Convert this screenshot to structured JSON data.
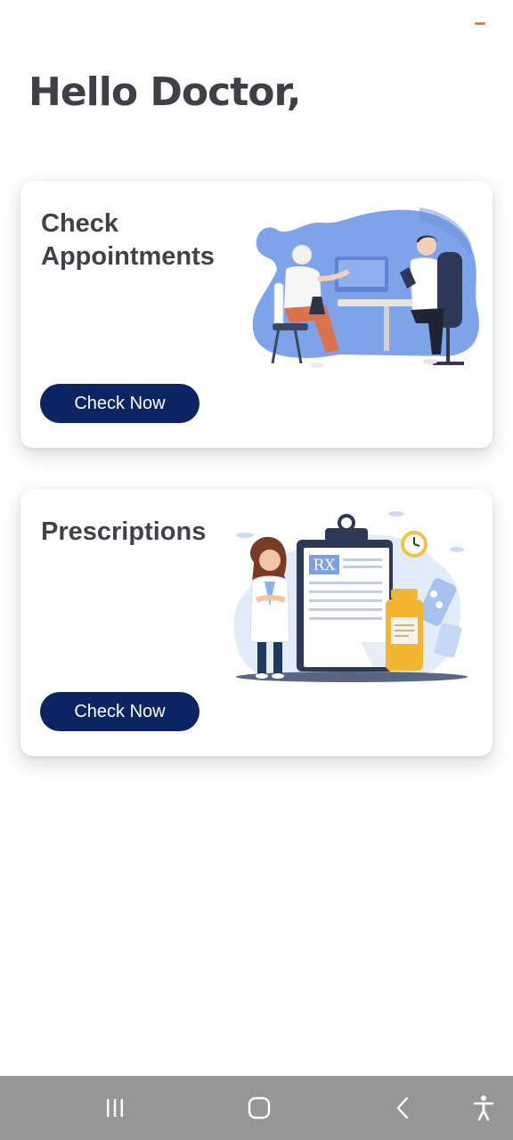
{
  "header": {
    "greeting": "Hello Doctor,"
  },
  "cards": [
    {
      "id": "appointments",
      "title": "Check Appointments",
      "button_label": "Check Now",
      "illustration": "doctor-patient-consultation-illustration"
    },
    {
      "id": "prescriptions",
      "title": "Prescriptions",
      "button_label": "Check Now",
      "illustration": "prescription-clipboard-illustration",
      "illustration_text": "RX"
    }
  ],
  "navigation": {
    "recents_icon": "recent-apps-icon",
    "home_icon": "home-icon",
    "back_icon": "back-icon",
    "accessibility_icon": "accessibility-icon"
  },
  "colors": {
    "primary_button": "#0c2462",
    "title_text": "#3f3f48",
    "menu_accent": "#e9764a",
    "nav_bar": "#969696",
    "illustration_blue": "#7fa3e8"
  }
}
